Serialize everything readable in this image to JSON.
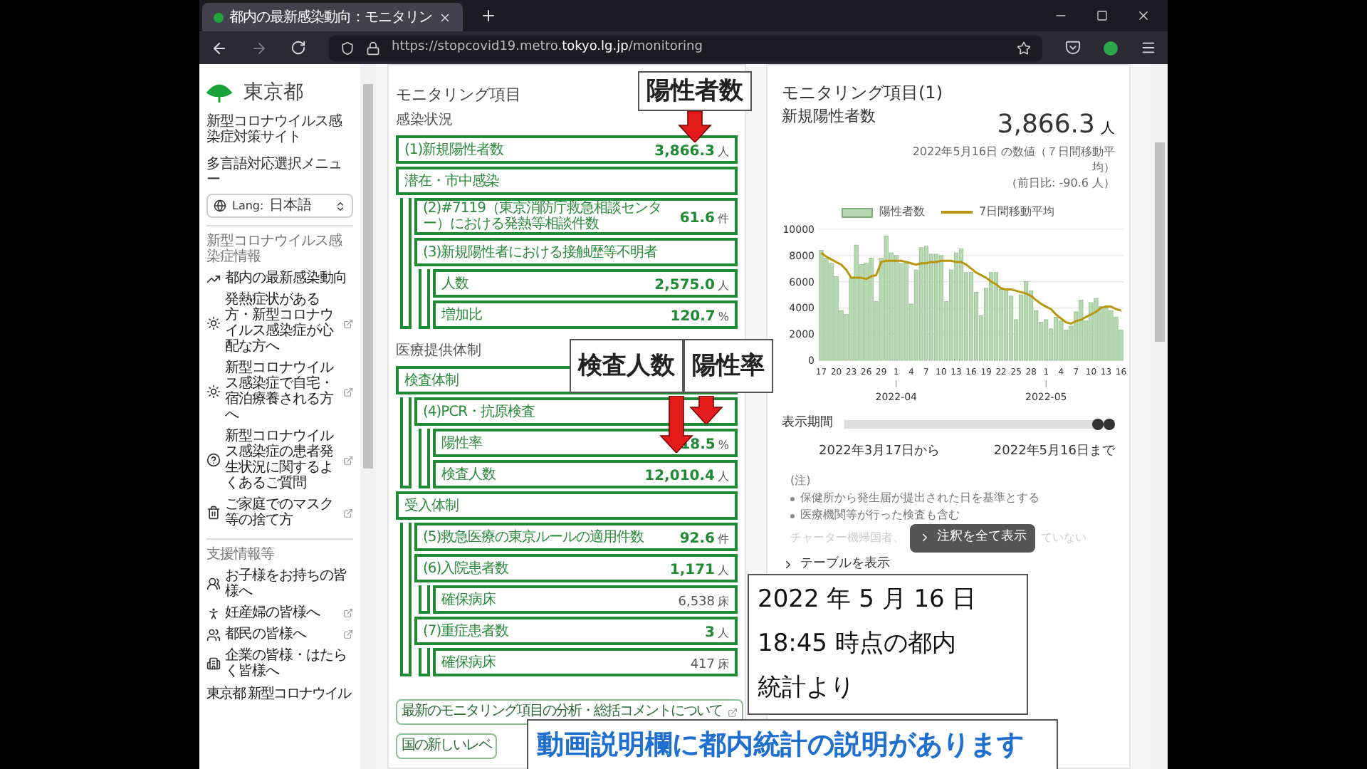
{
  "browser": {
    "tab_title": "都内の最新感染動向：モニタリン",
    "url": "https://stopcovid19.metro.**tokyo.lg.jp**/monitoring"
  },
  "sidebar": {
    "logo": "東京都",
    "subtitle": "新型コロナウイルス感染症対策サイト",
    "language_menu_label": "多言語対応選択メニュー",
    "language_select": {
      "prefix": "Lang:",
      "value": "日本語"
    },
    "sections": [
      {
        "title": "新型コロナウイルス感染症情報",
        "items": [
          {
            "label": "都内の最新感染動向",
            "external": false
          },
          {
            "label": "発熱症状がある方・新型コロナウイルス感染症が心配な方へ",
            "external": true
          },
          {
            "label": "新型コロナウイルス感染症で自宅・宿泊療養される方へ",
            "external": true
          },
          {
            "label": "新型コロナウイルス感染症の患者発生状況に関するよくあるご質問",
            "external": true
          },
          {
            "label": "ご家庭でのマスク等の捨て方",
            "external": true
          }
        ]
      },
      {
        "title": "支援情報等",
        "items": [
          {
            "label": "お子様をお持ちの皆様へ",
            "external": false
          },
          {
            "label": "妊産婦の皆様へ",
            "external": true
          },
          {
            "label": "都民の皆様へ",
            "external": true
          },
          {
            "label": "企業の皆様・はたらく皆様へ",
            "external": false
          }
        ]
      }
    ],
    "cut_item": "東京都 新型コロナウイル"
  },
  "monitoring": {
    "title": "モニタリング項目",
    "sections": [
      {
        "title": "感染状況",
        "items": [
          {
            "kind": "metric",
            "label": "(1)新規陽性者数",
            "value": "3,866.3",
            "unit": "人"
          },
          {
            "kind": "group",
            "label": "潜在・市中感染",
            "children": [
              {
                "kind": "metric",
                "label": "(2)#7119（東京消防庁救急相談センター）における発熱等相談件数",
                "value": "61.6",
                "unit": "件"
              },
              {
                "kind": "group",
                "label": "(3)新規陽性者における接触歴等不明者",
                "children": [
                  {
                    "kind": "metric",
                    "label": "人数",
                    "value": "2,575.0",
                    "unit": "人"
                  },
                  {
                    "kind": "metric",
                    "label": "増加比",
                    "value": "120.7",
                    "unit": "%"
                  }
                ]
              }
            ]
          }
        ]
      },
      {
        "title": "医療提供体制",
        "items": [
          {
            "kind": "group",
            "label": "検査体制",
            "children": [
              {
                "kind": "group",
                "label": "(4)PCR・抗原検査",
                "children": [
                  {
                    "kind": "metric",
                    "label": "陽性率",
                    "value": "18.5",
                    "unit": "%"
                  },
                  {
                    "kind": "metric",
                    "label": "検査人数",
                    "value": "12,010.4",
                    "unit": "人"
                  }
                ]
              }
            ]
          },
          {
            "kind": "group",
            "label": "受入体制",
            "children": [
              {
                "kind": "metric",
                "label": "(5)救急医療の東京ルールの適用件数",
                "value": "92.6",
                "unit": "件"
              },
              {
                "kind": "group",
                "label": "(6)入院患者数",
                "value": "1,171",
                "unit": "人",
                "children": [
                  {
                    "kind": "capacity",
                    "label": "確保病床",
                    "value": "6,538",
                    "unit": "床"
                  }
                ]
              },
              {
                "kind": "group",
                "label": "(7)重症患者数",
                "value": "3",
                "unit": "人",
                "children": [
                  {
                    "kind": "capacity",
                    "label": "確保病床",
                    "value": "417",
                    "unit": "床"
                  }
                ]
              }
            ]
          }
        ]
      }
    ],
    "links": [
      {
        "label": "最新のモニタリング項目の分析・総括コメントについて",
        "external": true
      },
      {
        "label": "国の新しいレベ",
        "external": false
      }
    ]
  },
  "detail": {
    "title": "モニタリング項目(1)",
    "subtitle": "新規陽性者数",
    "value": "3,866.3",
    "unit": "人",
    "note": "2022年5月16日 の数値（７日間移動平均）",
    "change": "（前日比: -90.6 人）",
    "chart_data": {
      "type": "bar",
      "grid": true,
      "categories": [
        "17",
        null,
        null,
        "20",
        null,
        null,
        "23",
        null,
        null,
        "26",
        null,
        null,
        "29",
        null,
        null,
        "1",
        null,
        null,
        "4",
        null,
        null,
        "7",
        null,
        null,
        "10",
        null,
        null,
        "13",
        null,
        null,
        "16",
        null,
        null,
        "19",
        null,
        null,
        "22",
        null,
        null,
        "25",
        null,
        null,
        "28",
        null,
        null,
        "1",
        null,
        null,
        "4",
        null,
        null,
        "7",
        null,
        null,
        "10",
        null,
        null,
        "13",
        null,
        null,
        "16"
      ],
      "series": [
        {
          "name": "陽性者数",
          "color": "#b7d9b1",
          "values": [
            8400,
            7800,
            7400,
            6400,
            3800,
            3500,
            6300,
            8800,
            7300,
            7400,
            7800,
            4500,
            7800,
            9500,
            8200,
            8000,
            7400,
            7400,
            4300,
            6900,
            8600,
            8700,
            8100,
            8100,
            8000,
            4500,
            6900,
            8200,
            8500,
            6700,
            6700,
            5200,
            3400,
            5500,
            6700,
            6700,
            5400,
            5400,
            4900,
            3100,
            5000,
            6000,
            5300,
            3800,
            2900,
            3100,
            2400,
            3300,
            3000,
            2300,
            2600,
            3700,
            4600,
            3000,
            4400,
            4700,
            4100,
            4000,
            3800,
            3300,
            2300
          ]
        },
        {
          "name": "7日間移動平均",
          "type": "line",
          "color": "#b8970f",
          "values": [
            8200,
            7900,
            7700,
            7500,
            7300,
            6900,
            6300,
            6300,
            6300,
            6200,
            6400,
            6500,
            7500,
            7600,
            7600,
            7600,
            7600,
            7500,
            7400,
            7300,
            7400,
            7400,
            7500,
            7500,
            7600,
            7600,
            7600,
            7500,
            7500,
            7300,
            7000,
            6700,
            6500,
            6300,
            6000,
            5800,
            5500,
            5400,
            5400,
            5300,
            5200,
            5100,
            4900,
            4600,
            4300,
            4100,
            3900,
            3500,
            3200,
            2900,
            2800,
            3000,
            3100,
            3300,
            3500,
            3700,
            4000,
            4100,
            4100,
            3900,
            3800
          ]
        }
      ],
      "ylim": [
        0,
        10000
      ],
      "yticks": [
        0,
        2000,
        4000,
        6000,
        8000,
        10000
      ],
      "annotations": [
        "2022-04",
        "2022-05"
      ]
    },
    "period": {
      "label": "表示期間",
      "thumbs": [
        {
          "level": 0.96
        },
        {
          "level": 1
        }
      ],
      "from": "2022年3月17日から",
      "to": "2022年5月16日まで"
    },
    "notes": {
      "heading": "(注)",
      "items": [
        "保健所から発生届が提出された日を基準とする",
        "医療機関等が行った検査も含む"
      ],
      "faded_start": "チャーター機帰国者、",
      "faded_end": "ていない",
      "expand_button": "注釈を全て表示"
    },
    "table_toggle": "テーブルを表示"
  },
  "annotations": [
    {
      "kind": "callout",
      "text": "陽性者数"
    },
    {
      "kind": "callout",
      "text": "検査人数"
    },
    {
      "kind": "callout",
      "text": "陽性率"
    },
    {
      "kind": "caption",
      "lines": [
        "2022 年 5 月 16 日",
        "18:45 時点の都内",
        "統計より"
      ]
    },
    {
      "kind": "banner",
      "text": "動画説明欄に都内統計の説明があります"
    }
  ]
}
